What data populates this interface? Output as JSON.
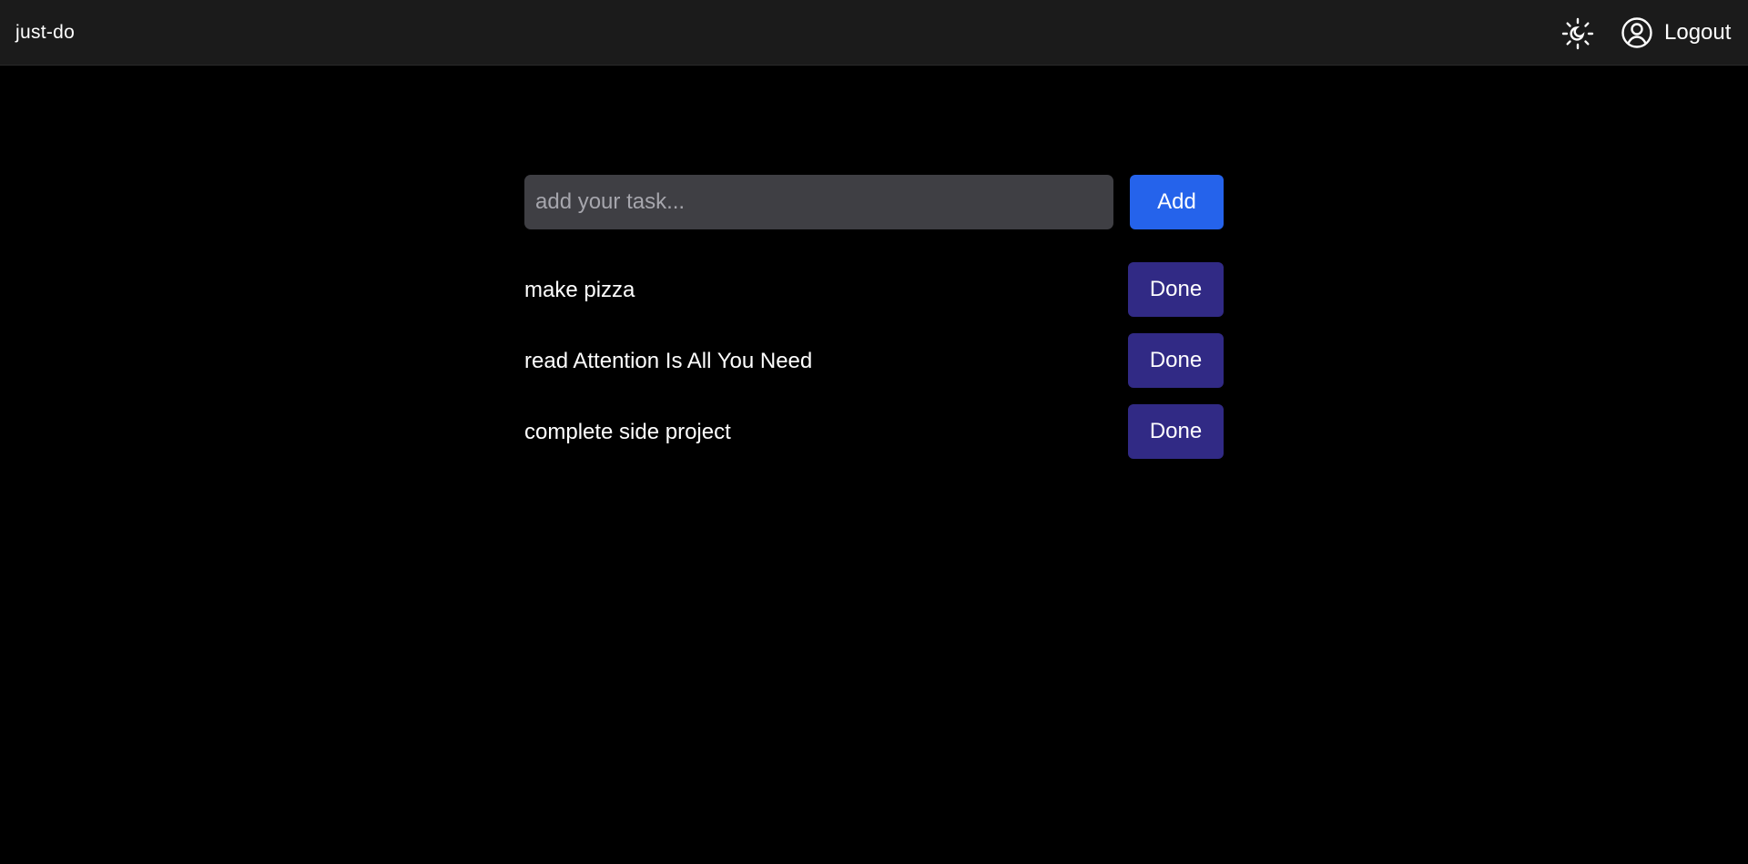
{
  "header": {
    "brand": "just-do",
    "theme_toggle_icon": "sun-moon-icon",
    "user_icon": "user-circle-icon",
    "logout_label": "Logout"
  },
  "composer": {
    "input_value": "",
    "input_placeholder": "add your task...",
    "add_label": "Add"
  },
  "tasks": [
    {
      "text": "make pizza",
      "done_label": "Done"
    },
    {
      "text": "read Attention Is All You Need",
      "done_label": "Done"
    },
    {
      "text": "complete side project",
      "done_label": "Done"
    }
  ],
  "colors": {
    "background": "#000000",
    "header": "#1b1b1b",
    "input": "#3f3f44",
    "add_button": "#2563eb",
    "done_button": "#312a85"
  }
}
